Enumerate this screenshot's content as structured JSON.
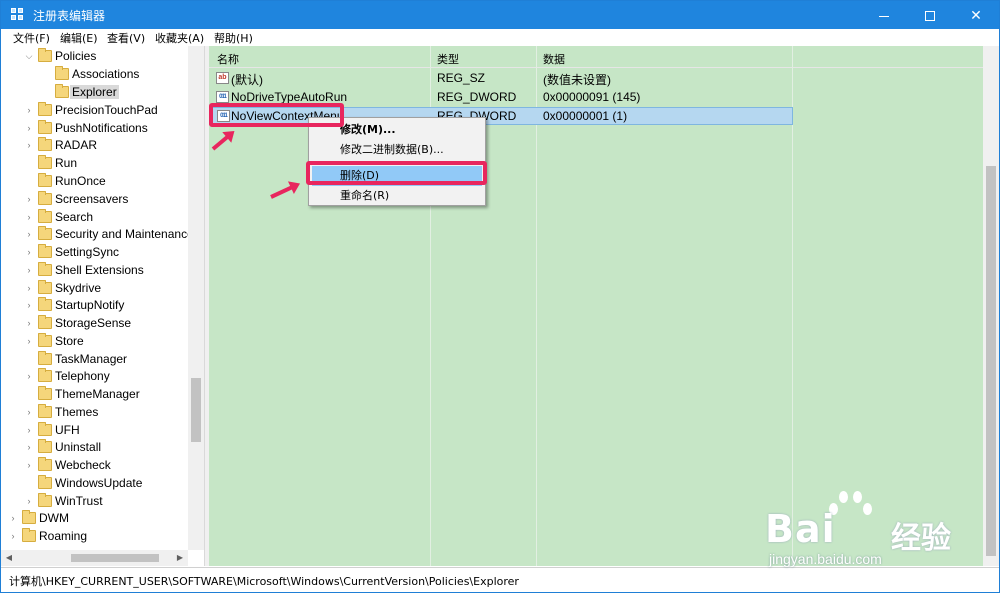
{
  "window": {
    "title": "注册表编辑器",
    "controls": {
      "minimize": "",
      "maximize": "",
      "close": "✕"
    }
  },
  "menu": [
    "文件(F)",
    "编辑(E)",
    "查看(V)",
    "收藏夹(A)",
    "帮助(H)"
  ],
  "tree": {
    "items": [
      {
        "label": "Policies",
        "expanded": true
      },
      {
        "label": "Associations"
      },
      {
        "label": "Explorer",
        "selected": true
      },
      {
        "label": "PrecisionTouchPad"
      },
      {
        "label": "PushNotifications"
      },
      {
        "label": "RADAR"
      },
      {
        "label": "Run"
      },
      {
        "label": "RunOnce"
      },
      {
        "label": "Screensavers"
      },
      {
        "label": "Search"
      },
      {
        "label": "Security and Maintenance"
      },
      {
        "label": "SettingSync"
      },
      {
        "label": "Shell Extensions"
      },
      {
        "label": "Skydrive"
      },
      {
        "label": "StartupNotify"
      },
      {
        "label": "StorageSense"
      },
      {
        "label": "Store"
      },
      {
        "label": "TaskManager"
      },
      {
        "label": "Telephony"
      },
      {
        "label": "ThemeManager"
      },
      {
        "label": "Themes"
      },
      {
        "label": "UFH"
      },
      {
        "label": "Uninstall"
      },
      {
        "label": "Webcheck"
      },
      {
        "label": "WindowsUpdate"
      },
      {
        "label": "WinTrust"
      },
      {
        "label": "DWM"
      },
      {
        "label": "Roaming"
      }
    ]
  },
  "list": {
    "headers": {
      "name": "名称",
      "type": "类型",
      "data": "数据"
    },
    "rows": [
      {
        "icon": "ab",
        "name": "(默认)",
        "type": "REG_SZ",
        "data": "(数值未设置)"
      },
      {
        "icon": "011",
        "name": "NoDriveTypeAutoRun",
        "type": "REG_DWORD",
        "data": "0x00000091 (145)"
      },
      {
        "icon": "011",
        "name": "NoViewContextMenu",
        "type": "REG_DWORD",
        "data": "0x00000001 (1)",
        "selected": true
      }
    ]
  },
  "context_menu": {
    "modify": "修改(M)...",
    "modify_binary": "修改二进制数据(B)...",
    "delete": "删除(D)",
    "rename": "重命名(R)"
  },
  "status": {
    "path": "计算机\\HKEY_CURRENT_USER\\SOFTWARE\\Microsoft\\Windows\\CurrentVersion\\Policies\\Explorer"
  },
  "watermark": {
    "brand": "Bai",
    "brand_cn": "经验",
    "url": "jingyan.baidu.com"
  },
  "colors": {
    "accent": "#1f85de",
    "highlight": "#e8265e",
    "list_bg": "#c6e6c6",
    "selection": "#91c9f7"
  }
}
